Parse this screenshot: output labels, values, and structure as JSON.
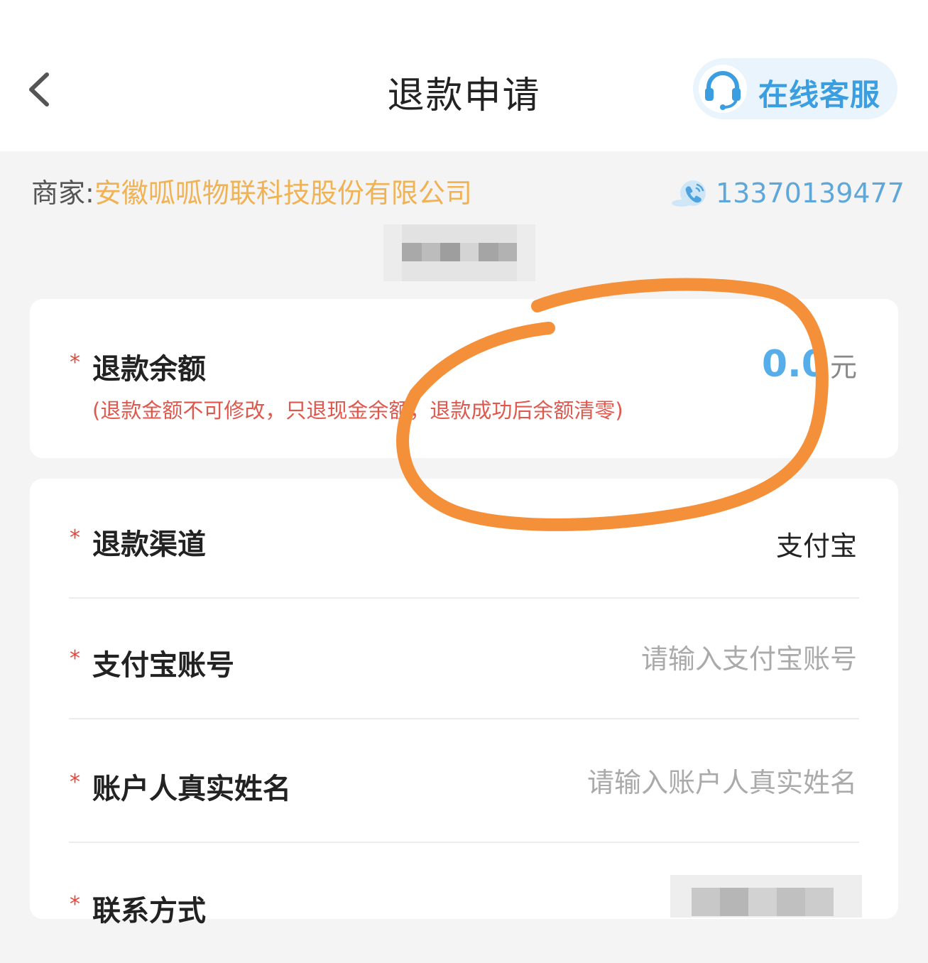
{
  "header": {
    "title": "退款申请",
    "service_label": "在线客服"
  },
  "merchant": {
    "prefix": "商家:",
    "name": "安徽呱呱物联科技股份有限公司",
    "phone": "13370139477"
  },
  "balance": {
    "label": "退款余额",
    "required_mark": "*",
    "note": "(退款金额不可修改，只退现金余额，退款成功后余额清零)",
    "amount": "0.0",
    "unit": "元"
  },
  "form": {
    "channel_label": "退款渠道",
    "channel_value": "支付宝",
    "account_label": "支付宝账号",
    "account_placeholder": "请输入支付宝账号",
    "name_label": "账户人真实姓名",
    "name_placeholder": "请输入账户人真实姓名",
    "contact_label": "联系方式",
    "required_mark": "*"
  },
  "colors": {
    "accent_blue": "#55aeea",
    "merchant_orange": "#f0b253",
    "required_red": "#e04a3f",
    "annotation_orange": "#f5903a"
  },
  "icons": {
    "back": "chevron-left-icon",
    "service": "headset-icon",
    "phone": "phone-icon"
  }
}
